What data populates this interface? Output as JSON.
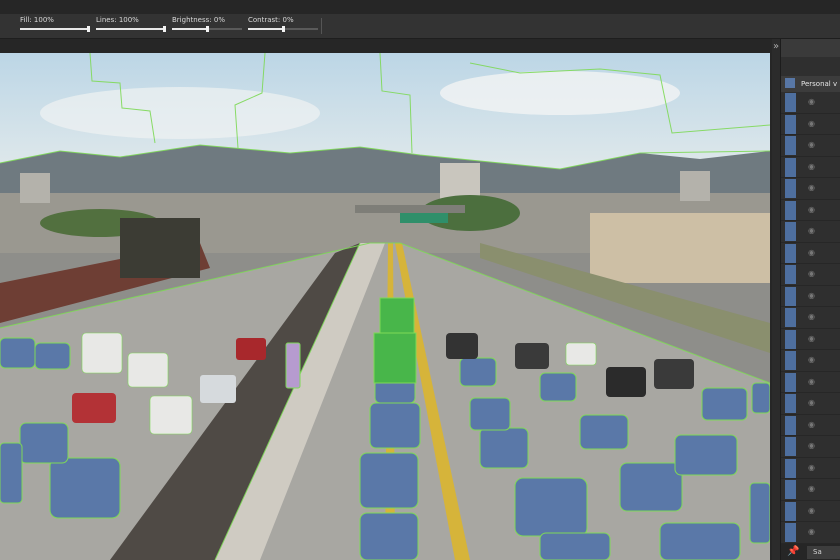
{
  "toolbar": {
    "fill_label": "Fill: 100%",
    "lines_label": "Lines: 100%",
    "brightness_label": "Brightness: 0%",
    "contrast_label": "Contrast: 0%",
    "fill_value": 1.0,
    "lines_value": 1.0,
    "brightness_value": 0.5,
    "contrast_value": 0.5
  },
  "panel": {
    "collapse_glyph": "»",
    "layer_title": "Personal v",
    "eye_glyph": "◉",
    "pin_glyph": "📌",
    "footer_button": "Sa"
  },
  "colors": {
    "overlay_fill": "#5a78a8",
    "overlay_outline": "#7ed957",
    "panel_swatch": "#4e6f9f"
  },
  "image": {
    "subject": "annotated-highway-photo"
  }
}
